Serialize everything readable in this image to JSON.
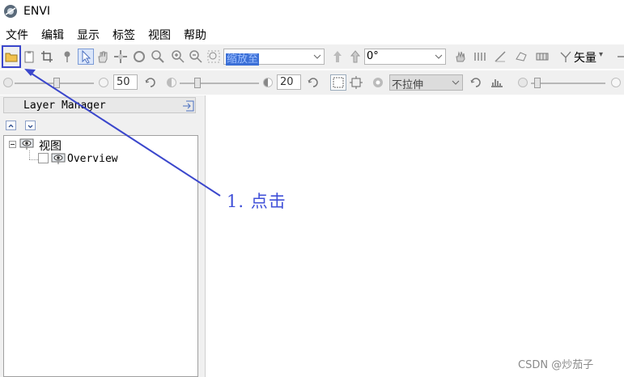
{
  "window": {
    "title": "ENVI"
  },
  "menu": [
    "文件",
    "编辑",
    "显示",
    "标签",
    "视图",
    "帮助"
  ],
  "toolbar1": {
    "zoom_combo_value": "缩放至",
    "rotation_value": "0°",
    "vector_label": "矢量"
  },
  "toolbar2": {
    "brightness_value": "50",
    "contrast_value": "20",
    "stretch_value": "不拉伸"
  },
  "layer_manager": {
    "title": "Layer Manager",
    "tree": {
      "root_label": "视图",
      "child_label": "Overview"
    }
  },
  "annotation": {
    "text": "1. 点击"
  },
  "watermark": "CSDN @炒茄子",
  "colors": {
    "annotation": "#3b47cc",
    "selection": "#3b6fd6"
  }
}
